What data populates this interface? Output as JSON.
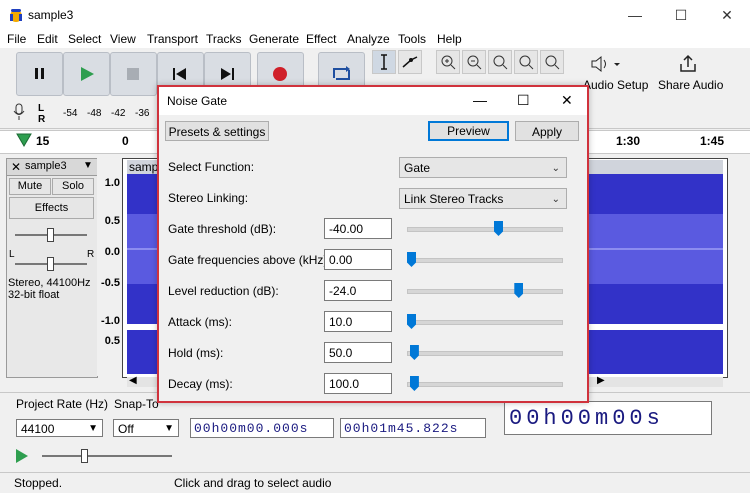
{
  "window": {
    "title": "sample3",
    "minimize": "—",
    "maximize": "☐",
    "close": "✕"
  },
  "menu": [
    "File",
    "Edit",
    "Select",
    "View",
    "Transport",
    "Tracks",
    "Generate",
    "Effect",
    "Analyze",
    "Tools",
    "Help"
  ],
  "toolbar": {
    "audio_setup": "Audio Setup",
    "share_audio": "Share Audio",
    "meter_labels": [
      "-54",
      "-48",
      "-42",
      "-36"
    ],
    "lr": [
      "L",
      "R"
    ]
  },
  "ruler": {
    "labels": [
      "15",
      "0",
      "1:30",
      "1:45"
    ]
  },
  "track": {
    "name": "sample3",
    "clip_name": "samp",
    "mute": "Mute",
    "solo": "Solo",
    "effects": "Effects",
    "info1": "Stereo, 44100Hz",
    "info2": "32-bit float",
    "pan_l": "L",
    "pan_r": "R",
    "scale": [
      "1.0",
      "0.5",
      "0.0",
      "-0.5",
      "-1.0",
      "0.5"
    ]
  },
  "bottom": {
    "project_rate_label": "Project Rate (Hz)",
    "project_rate": "44100",
    "snap_label": "Snap-To",
    "snap_value": "Off",
    "start_time": "00h00m00.000s",
    "end_time": "00h01m45.822s",
    "big_time": "00h00m00s"
  },
  "status": {
    "state": "Stopped.",
    "hint": "Click and drag to select audio"
  },
  "dialog": {
    "title": "Noise Gate",
    "presets": "Presets & settings",
    "preview": "Preview",
    "apply": "Apply",
    "select_function": {
      "label": "Select Function:",
      "value": "Gate"
    },
    "stereo_linking": {
      "label": "Stereo Linking:",
      "value": "Link Stereo Tracks"
    },
    "params": [
      {
        "label": "Gate threshold (dB):",
        "value": "-40.00",
        "slider": 0.6
      },
      {
        "label": "Gate frequencies above (kHz):",
        "value": "0.00",
        "slider": 0.0
      },
      {
        "label": "Level reduction (dB):",
        "value": "-24.0",
        "slider": 0.74
      },
      {
        "label": "Attack (ms):",
        "value": "10.0",
        "slider": 0.0
      },
      {
        "label": "Hold (ms):",
        "value": "50.0",
        "slider": 0.02
      },
      {
        "label": "Decay (ms):",
        "value": "100.0",
        "slider": 0.02
      }
    ]
  },
  "colors": {
    "accent": "#0078d7",
    "waveform": "#3232c8",
    "dialog_border": "#d0323c",
    "play": "#2e9e4f",
    "record": "#d0202a"
  }
}
